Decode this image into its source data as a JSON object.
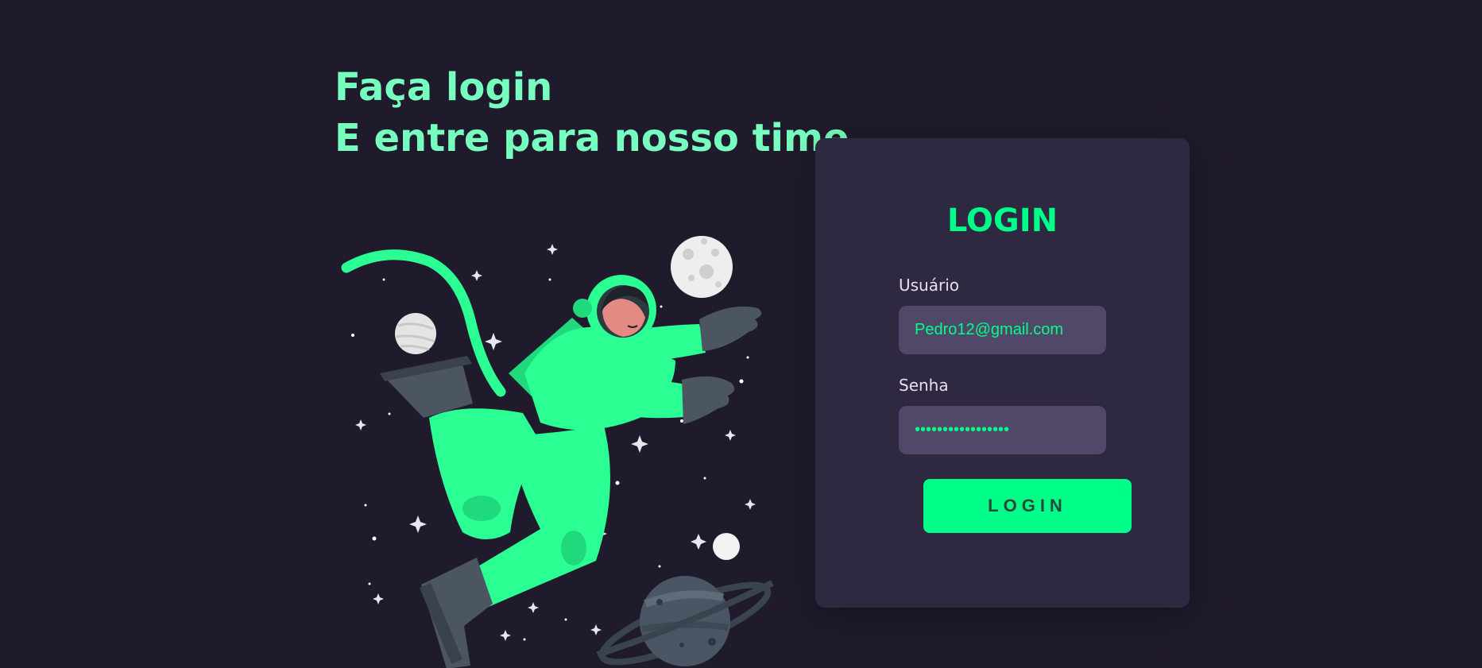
{
  "headline": {
    "line1": "Faça login",
    "line2": "E entre para nosso time"
  },
  "card": {
    "title": "LOGIN",
    "username_label": "Usuário",
    "username_value": "Pedro12@gmail.com",
    "password_label": "Senha",
    "password_value": "•••••••••••••••••",
    "submit_label": "LOGIN"
  },
  "colors": {
    "background": "#201b2c",
    "card": "#2f2841",
    "input": "#514869",
    "accent": "#00ff88",
    "headline": "#77ffc0"
  },
  "icons": [
    "astronaut-illustration",
    "moon-icon",
    "planet-icon",
    "saturn-icon",
    "star-icon"
  ]
}
